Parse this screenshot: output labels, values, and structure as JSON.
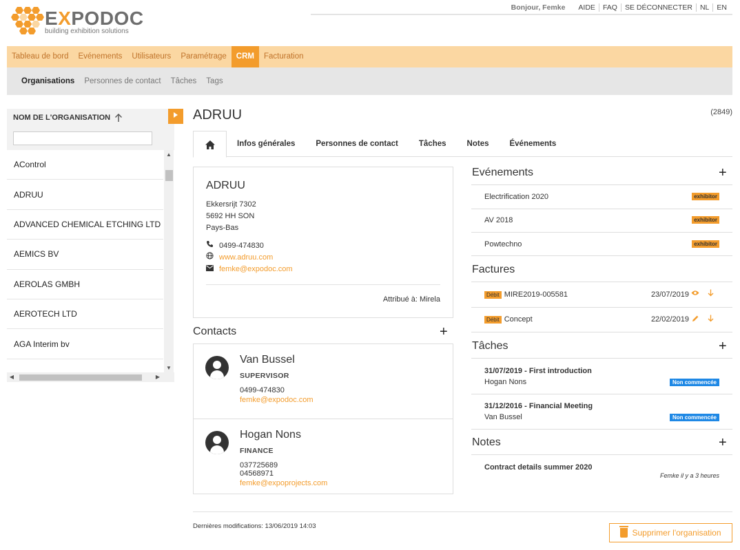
{
  "brand": {
    "name_pre": "E",
    "name_x": "X",
    "name_post": "PODOC",
    "tagline": "building exhibition solutions",
    "accent": "#f39c2c"
  },
  "topbar": {
    "greeting": "Bonjour, Femke",
    "links": [
      "AIDE",
      "FAQ",
      "SE DÉCONNECTER",
      "NL",
      "EN"
    ]
  },
  "mainnav": [
    "Tableau de bord",
    "Evénements",
    "Utilisateurs",
    "Paramétrage",
    "CRM",
    "Facturation"
  ],
  "mainnav_active": "CRM",
  "subnav": [
    "Organisations",
    "Personnes de contact",
    "Tâches",
    "Tags"
  ],
  "subnav_active": "Organisations",
  "list": {
    "header": "NOM DE L'ORGANISATION",
    "filter_value": "",
    "items": [
      "AControl",
      "ADRUU",
      "ADVANCED CHEMICAL ETCHING LTD",
      "AEMICS BV",
      "AEROLAS GMBH",
      "AEROTECH LTD",
      "AGA Interim bv"
    ]
  },
  "org": {
    "title": "ADRUU",
    "count": "(2849)",
    "tabs": [
      "Infos générales",
      "Personnes de contact",
      "Tâches",
      "Notes",
      "Événements"
    ],
    "card": {
      "name": "ADRUU",
      "street": "Ekkersrijt 7302",
      "city": "5692 HH SON",
      "country": "Pays-Bas",
      "phone": "0499-474830",
      "website": "www.adruu.com",
      "email": "femke@expodoc.com",
      "assigned": "Attribué à: Mirela"
    }
  },
  "contacts": {
    "title": "Contacts",
    "items": [
      {
        "name": "Van Bussel",
        "role": "SUPERVISOR",
        "phones": [
          "0499-474830"
        ],
        "email": "femke@expodoc.com"
      },
      {
        "name": "Hogan Nons",
        "role": "FINANCE",
        "phones": [
          "037725689",
          "04568971"
        ],
        "email": "femke@expoprojects.com"
      }
    ]
  },
  "events": {
    "title": "Evénements",
    "items": [
      {
        "name": "Electrification 2020",
        "badge": "exhibitor"
      },
      {
        "name": "AV 2018",
        "badge": "exhibitor"
      },
      {
        "name": "Powtechno",
        "badge": "exhibitor"
      }
    ]
  },
  "invoices": {
    "title": "Factures",
    "items": [
      {
        "type": "Débit",
        "name": "MIRE2019-005581",
        "date": "23/07/2019",
        "icon": "eye-icon"
      },
      {
        "type": "Débit",
        "name": "Concept",
        "date": "22/02/2019",
        "icon": "pencil-icon"
      }
    ]
  },
  "tasks": {
    "title": "Tâches",
    "items": [
      {
        "title": "31/07/2019 - First introduction",
        "person": "Hogan Nons",
        "status": "Non commencée"
      },
      {
        "title": "31/12/2016 - Financial Meeting",
        "person": "Van Bussel",
        "status": "Non commencée"
      }
    ]
  },
  "notes": {
    "title": "Notes",
    "items": [
      {
        "title": "Contract details summer 2020",
        "meta": "Femke il y a 3 heures"
      }
    ]
  },
  "footer": {
    "last_modified": "Dernières modifications: 13/06/2019 14:03",
    "delete_label": "Supprimer l'organisation"
  }
}
